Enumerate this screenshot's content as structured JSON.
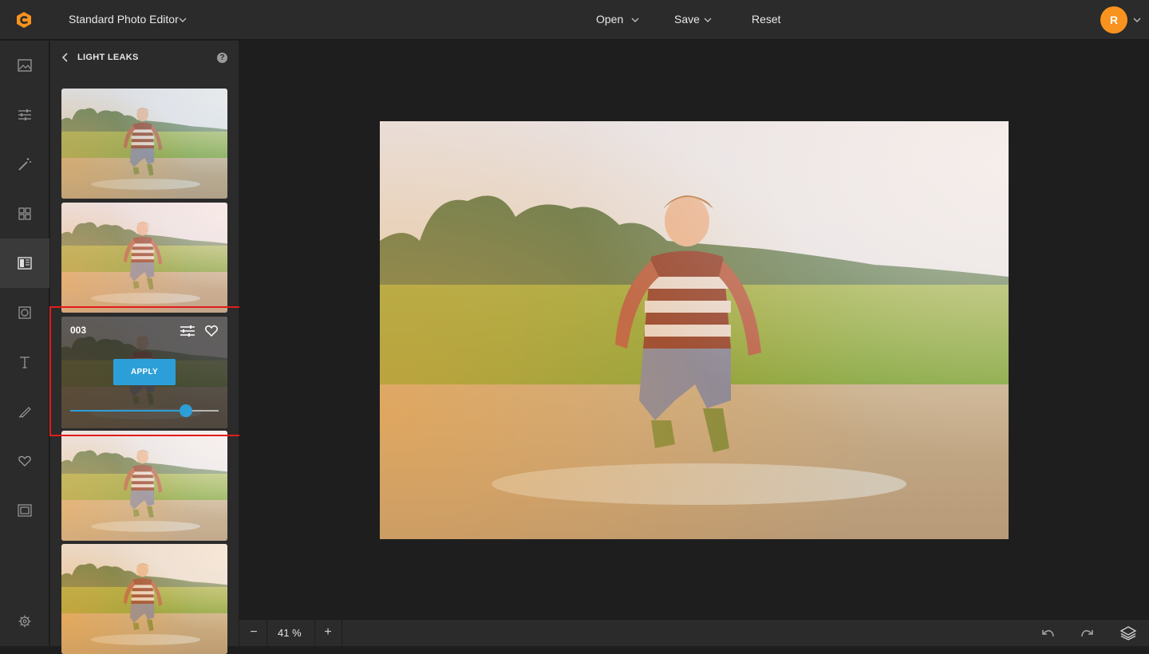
{
  "header": {
    "app_title": "Standard Photo Editor",
    "menu": [
      {
        "label": "Open"
      },
      {
        "label": "Save"
      },
      {
        "label": "Reset"
      }
    ],
    "avatar_initial": "R",
    "avatar_color": "#f7931e",
    "logo_color": "#f7931e"
  },
  "rail": {
    "items": [
      {
        "icon": "image-icon"
      },
      {
        "icon": "sliders-icon"
      },
      {
        "icon": "magic-wand-icon"
      },
      {
        "icon": "grid-icon"
      },
      {
        "icon": "texture-overlay-icon",
        "active": true
      },
      {
        "icon": "frame-circle-icon"
      },
      {
        "icon": "text-icon"
      },
      {
        "icon": "brush-icon"
      },
      {
        "icon": "heart-icon"
      },
      {
        "icon": "border-frame-icon"
      },
      {
        "icon": "settings-icon"
      }
    ]
  },
  "panel": {
    "title": "LIGHT LEAKS",
    "help": "?",
    "active_effect": {
      "name": "003",
      "apply_label": "APPLY",
      "intensity": 0.78
    }
  },
  "bottombar": {
    "zoom_minus": "−",
    "zoom_value": "41 %",
    "zoom_plus": "+"
  },
  "colors": {
    "accent": "#2d9fd8",
    "highlight_box": "#e31b1b"
  }
}
